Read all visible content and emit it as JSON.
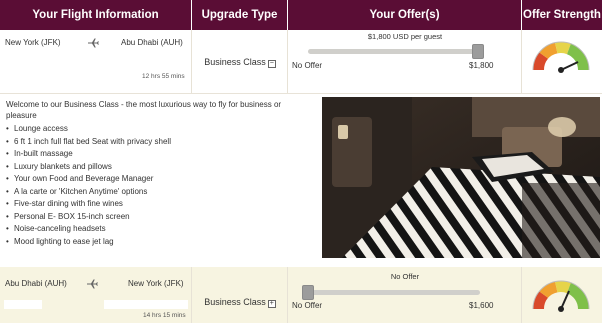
{
  "header": {
    "col_info": "Your Flight Information",
    "col_upgrade": "Upgrade Type",
    "col_offer": "Your Offer(s)",
    "col_strength": "Offer Strength"
  },
  "flights": [
    {
      "origin": "New York (JFK)",
      "destination": "Abu Dhabi (AUH)",
      "duration": "12 hrs 55 mins",
      "upgrade_label": "Business Class",
      "upgrade_toggle": "−",
      "offer_label": "$1,800 USD per guest",
      "slider_min_label": "No Offer",
      "slider_max_label": "$1,800",
      "offer_fraction": 1.0,
      "strength_fraction": 0.8
    },
    {
      "origin": "Abu Dhabi (AUH)",
      "destination": "New York (JFK)",
      "duration": "14 hrs 15 mins",
      "upgrade_label": "Business Class",
      "upgrade_toggle": "+",
      "offer_label": "No Offer",
      "slider_min_label": "No Offer",
      "slider_max_label": "$1,600",
      "offer_fraction": 0.0,
      "strength_fraction": 0.8
    }
  ],
  "details": {
    "intro": "Welcome to our Business Class - the most luxurious way to fly for business or pleasure",
    "features": [
      "Lounge access",
      "6 ft 1 inch full flat bed Seat with privacy shell",
      "In-built massage",
      "Luxury blankets and pillows",
      "Your own Food and Beverage Manager",
      "A la carte or 'Kitchen Anytime' options",
      "Five-star dining with fine wines",
      "Personal E- BOX 15-inch screen",
      "Noise-canceling headsets",
      "Mood lighting to ease jet lag"
    ]
  },
  "icons": {
    "plane": "airplane-icon",
    "gauge": "gauge-icon"
  },
  "colors": {
    "header_bg": "#5a0d35",
    "row2_bg": "#f7f4e1",
    "gauge_red": "#d94a2b",
    "gauge_orange": "#f0a030",
    "gauge_yellow": "#e6d44a",
    "gauge_green": "#7fc04a"
  }
}
